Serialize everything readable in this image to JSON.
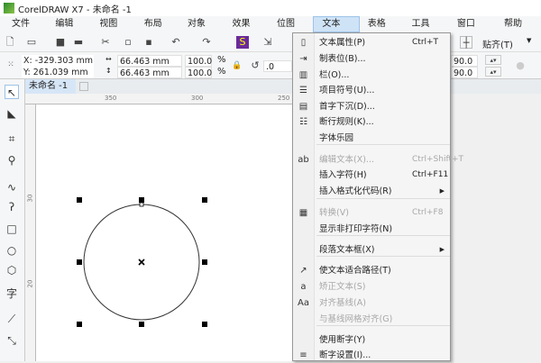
{
  "title": "CorelDRAW X7 - 未命名 -1",
  "menubar": [
    "文件(F)",
    "编辑(E)",
    "视图(V)",
    "布局(L)",
    "对象(C)",
    "效果(C)",
    "位图(B)",
    "文本(X)",
    "表格(T)",
    "工具(O)",
    "窗口(W)",
    "帮助(H)"
  ],
  "toolbar": {
    "snap_label": "贴齐(T)"
  },
  "propbar": {
    "x": "X: -329.303 mm",
    "y": "Y: 261.039 mm",
    "width": "66.463 mm",
    "height": "66.463 mm",
    "scale_x": "100.0",
    "scale_y": "100.0",
    "pct": "%",
    "rotation": ".0",
    "angle1": "90.0 °",
    "angle2": "90.0 °"
  },
  "doc_tab": "未命名 -1",
  "ruler": {
    "h": [
      "350",
      "300",
      "250"
    ],
    "v": [
      "30",
      "20"
    ]
  },
  "text_menu": {
    "items": [
      {
        "label": "文本属性(P)",
        "shortcut": "Ctrl+T",
        "icon": "text-properties-icon",
        "g": "▯"
      },
      {
        "label": "制表位(B)...",
        "icon": "tabs-icon",
        "g": "⇥"
      },
      {
        "label": "栏(O)...",
        "icon": "columns-icon",
        "g": "▥"
      },
      {
        "label": "项目符号(U)...",
        "icon": "bullets-icon",
        "g": "☰"
      },
      {
        "label": "首字下沉(D)...",
        "icon": "drop-cap-icon",
        "g": "▤"
      },
      {
        "label": "断行规则(K)...",
        "icon": "line-break-rules-icon",
        "g": "☷"
      },
      {
        "label": "字体乐园",
        "icon": "",
        "g": ""
      },
      {
        "label": "编辑文本(X)...",
        "shortcut": "Ctrl+Shift+T",
        "disabled": true,
        "icon": "edit-text-icon",
        "g": "ab"
      },
      {
        "label": "插入字符(H)",
        "shortcut": "Ctrl+F11",
        "icon": "",
        "g": ""
      },
      {
        "label": "插入格式化代码(R)",
        "submenu": true,
        "icon": "",
        "g": ""
      },
      {
        "label": "转换(V)",
        "shortcut": "Ctrl+F8",
        "disabled": true,
        "icon": "convert-icon",
        "g": "▦"
      },
      {
        "label": "显示非打印字符(N)",
        "icon": "",
        "g": ""
      },
      {
        "label": "段落文本框(X)",
        "submenu": true,
        "icon": "",
        "g": ""
      },
      {
        "label": "使文本适合路径(T)",
        "icon": "fit-text-to-path-icon",
        "g": "↗"
      },
      {
        "label": "矫正文本(S)",
        "disabled": true,
        "icon": "straighten-text-icon",
        "g": "a"
      },
      {
        "label": "对齐基线(A)",
        "disabled": true,
        "icon": "align-baseline-icon",
        "g": "Aa"
      },
      {
        "label": "与基线网格对齐(G)",
        "disabled": true,
        "icon": "",
        "g": ""
      },
      {
        "label": "使用断字(Y)",
        "icon": "",
        "g": ""
      },
      {
        "label": "断字设置(I)...",
        "icon": "hyphenation-settings-icon",
        "g": "≡"
      }
    ]
  },
  "colors": {
    "menu_active": "#cfe3f7",
    "accent": "#9cc3e8"
  }
}
